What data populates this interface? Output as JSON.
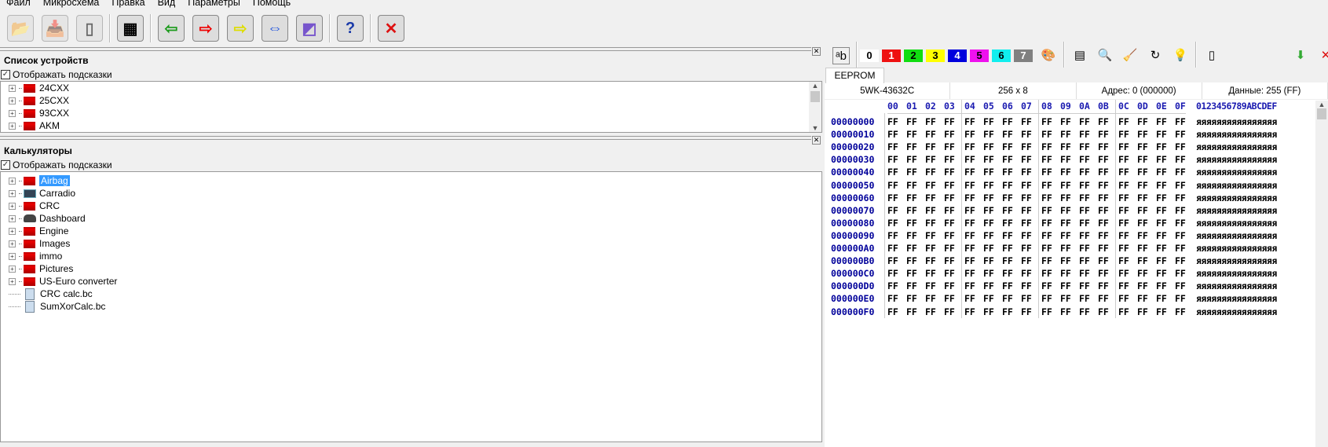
{
  "menu": [
    "Файл",
    "Микросхема",
    "Правка",
    "Вид",
    "Параметры",
    "Помощь"
  ],
  "toolbar": [
    {
      "name": "open-folder",
      "glyph": "📂",
      "disabled": true
    },
    {
      "name": "import-folder",
      "glyph": "📥",
      "disabled": true
    },
    {
      "name": "new-file",
      "glyph": "▯",
      "disabled": true
    },
    {
      "sep": true
    },
    {
      "name": "chip-select",
      "glyph": "▦"
    },
    {
      "sep": true
    },
    {
      "name": "read-chip",
      "glyph": "⇦",
      "color": "#1a9a1a"
    },
    {
      "name": "write-chip",
      "glyph": "⇨",
      "color": "#e00"
    },
    {
      "name": "verify-chip",
      "glyph": "⇨",
      "color": "#dd0"
    },
    {
      "name": "compare-chip",
      "glyph": "⇔",
      "color": "#2255dd"
    },
    {
      "name": "erase-chip",
      "glyph": "◩",
      "color": "#7755cc"
    },
    {
      "sep": true
    },
    {
      "name": "help",
      "glyph": "?",
      "color": "#1a3aa8"
    },
    {
      "sep": true
    },
    {
      "name": "exit",
      "glyph": "✕",
      "color": "#dd1111"
    }
  ],
  "devices": {
    "title": "Список устройств",
    "hints_label": "Отображать подсказки",
    "items": [
      "24CXX",
      "25CXX",
      "93CXX",
      "AKM"
    ]
  },
  "calculators": {
    "title": "Калькуляторы",
    "hints_label": "Отображать подсказки",
    "items": [
      {
        "label": "Airbag",
        "icon": "folder",
        "selected": true
      },
      {
        "label": "Carradio",
        "icon": "radio"
      },
      {
        "label": "CRC",
        "icon": "folder"
      },
      {
        "label": "Dashboard",
        "icon": "dashboard"
      },
      {
        "label": "Engine",
        "icon": "folder"
      },
      {
        "label": "Images",
        "icon": "folder"
      },
      {
        "label": "immo",
        "icon": "folder"
      },
      {
        "label": "Pictures",
        "icon": "folder"
      },
      {
        "label": "US-Euro converter",
        "icon": "folder"
      },
      {
        "label": "CRC calc.bc",
        "icon": "calculator",
        "leaf": true
      },
      {
        "label": "SumXorCalc.bc",
        "icon": "calculator",
        "leaf": true
      }
    ]
  },
  "editor": {
    "colors": [
      {
        "label": "0",
        "bg": "#ffffff",
        "fg": "#000"
      },
      {
        "label": "1",
        "bg": "#ee1111",
        "fg": "#fff"
      },
      {
        "label": "2",
        "bg": "#11dd11",
        "fg": "#000"
      },
      {
        "label": "3",
        "bg": "#ffff00",
        "fg": "#000"
      },
      {
        "label": "4",
        "bg": "#0000dd",
        "fg": "#fff"
      },
      {
        "label": "5",
        "bg": "#ee11ee",
        "fg": "#000"
      },
      {
        "label": "6",
        "bg": "#11eeee",
        "fg": "#000"
      },
      {
        "label": "7",
        "bg": "#808080",
        "fg": "#fff"
      }
    ],
    "tab": "EEPROM",
    "chip": "5WK-43632C",
    "size": "256 x 8",
    "address": "Адрес: 0 (000000)",
    "data": "Данные: 255 (FF)",
    "columns": [
      "00",
      "01",
      "02",
      "03",
      "04",
      "05",
      "06",
      "07",
      "08",
      "09",
      "0A",
      "0B",
      "0C",
      "0D",
      "0E",
      "0F"
    ],
    "ascii_header": "0123456789ABCDEF",
    "rows": [
      {
        "addr": "00000000"
      },
      {
        "addr": "00000010"
      },
      {
        "addr": "00000020"
      },
      {
        "addr": "00000030"
      },
      {
        "addr": "00000040"
      },
      {
        "addr": "00000050"
      },
      {
        "addr": "00000060"
      },
      {
        "addr": "00000070"
      },
      {
        "addr": "00000080"
      },
      {
        "addr": "00000090"
      },
      {
        "addr": "000000A0"
      },
      {
        "addr": "000000B0"
      },
      {
        "addr": "000000C0"
      },
      {
        "addr": "000000D0"
      },
      {
        "addr": "000000E0"
      },
      {
        "addr": "000000F0"
      }
    ],
    "byte_value": "FF",
    "ascii_value": "яяяяяяяяяяяяяяяя"
  }
}
